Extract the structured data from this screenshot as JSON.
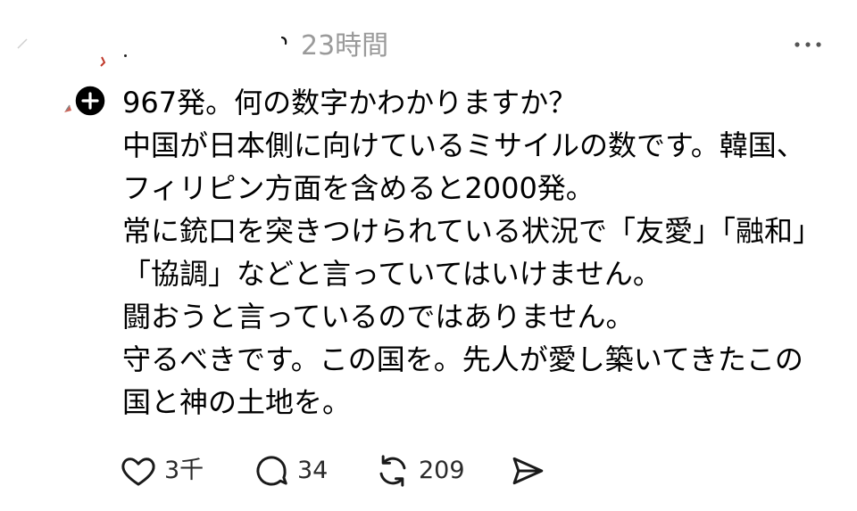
{
  "post": {
    "timestamp": "23時間",
    "body_lines": [
      "967発。何の数字かわかりますか？",
      "中国が日本側に向けているミサイルの数です。韓国、",
      "フィリピン方面を含めると2000発。",
      "常に銃口を突きつけられている状況で「友愛」「融和」",
      "「協調」などと言っていてはいけません。",
      "闘おうと言っているのではありません。",
      "守るべきです。この国を。先人が愛し築いてきたこの",
      "国と神の土地を。"
    ]
  },
  "actions": {
    "like_count": "3千",
    "reply_count": "34",
    "repost_count": "209"
  },
  "icons": {
    "avatar": "avatar",
    "follow": "plus-icon",
    "more": "more-horizontal-icon",
    "like": "heart-icon",
    "reply": "comment-icon",
    "repost": "repost-icon",
    "share": "send-icon"
  },
  "colors": {
    "text": "#000000",
    "timestamp": "#9a9a9a",
    "count": "#2a2a2a",
    "badge": "#000000",
    "avatar_accent": "#c0392b"
  }
}
